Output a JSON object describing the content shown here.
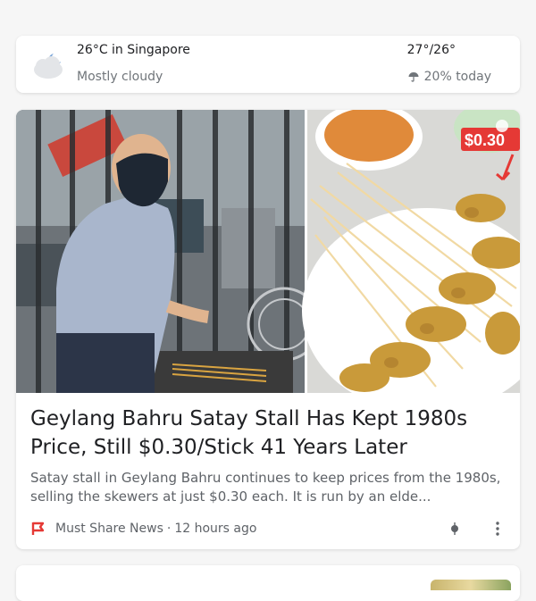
{
  "weather": {
    "location_temp": "26°C in Singapore",
    "condition": "Mostly cloudy",
    "high_low": "27°/26°",
    "rain_chance": "20% today",
    "icon": "cloud-moon-icon"
  },
  "article": {
    "image_badge": "$0.30",
    "headline": "Geylang Bahru Satay Stall Has Kept 1980s Price, Still $0.30/Stick 41 Years Later",
    "snippet": "Satay stall in Geylang Bahru continues to keep prices from the 1980s, selling the skewers at just $0.30 each. It is run by an elde...",
    "source": "Must Share News",
    "separator": "·",
    "time": "12 hours ago",
    "colors": {
      "source_logo": "#e53935",
      "badge_bg": "#e53935"
    }
  }
}
